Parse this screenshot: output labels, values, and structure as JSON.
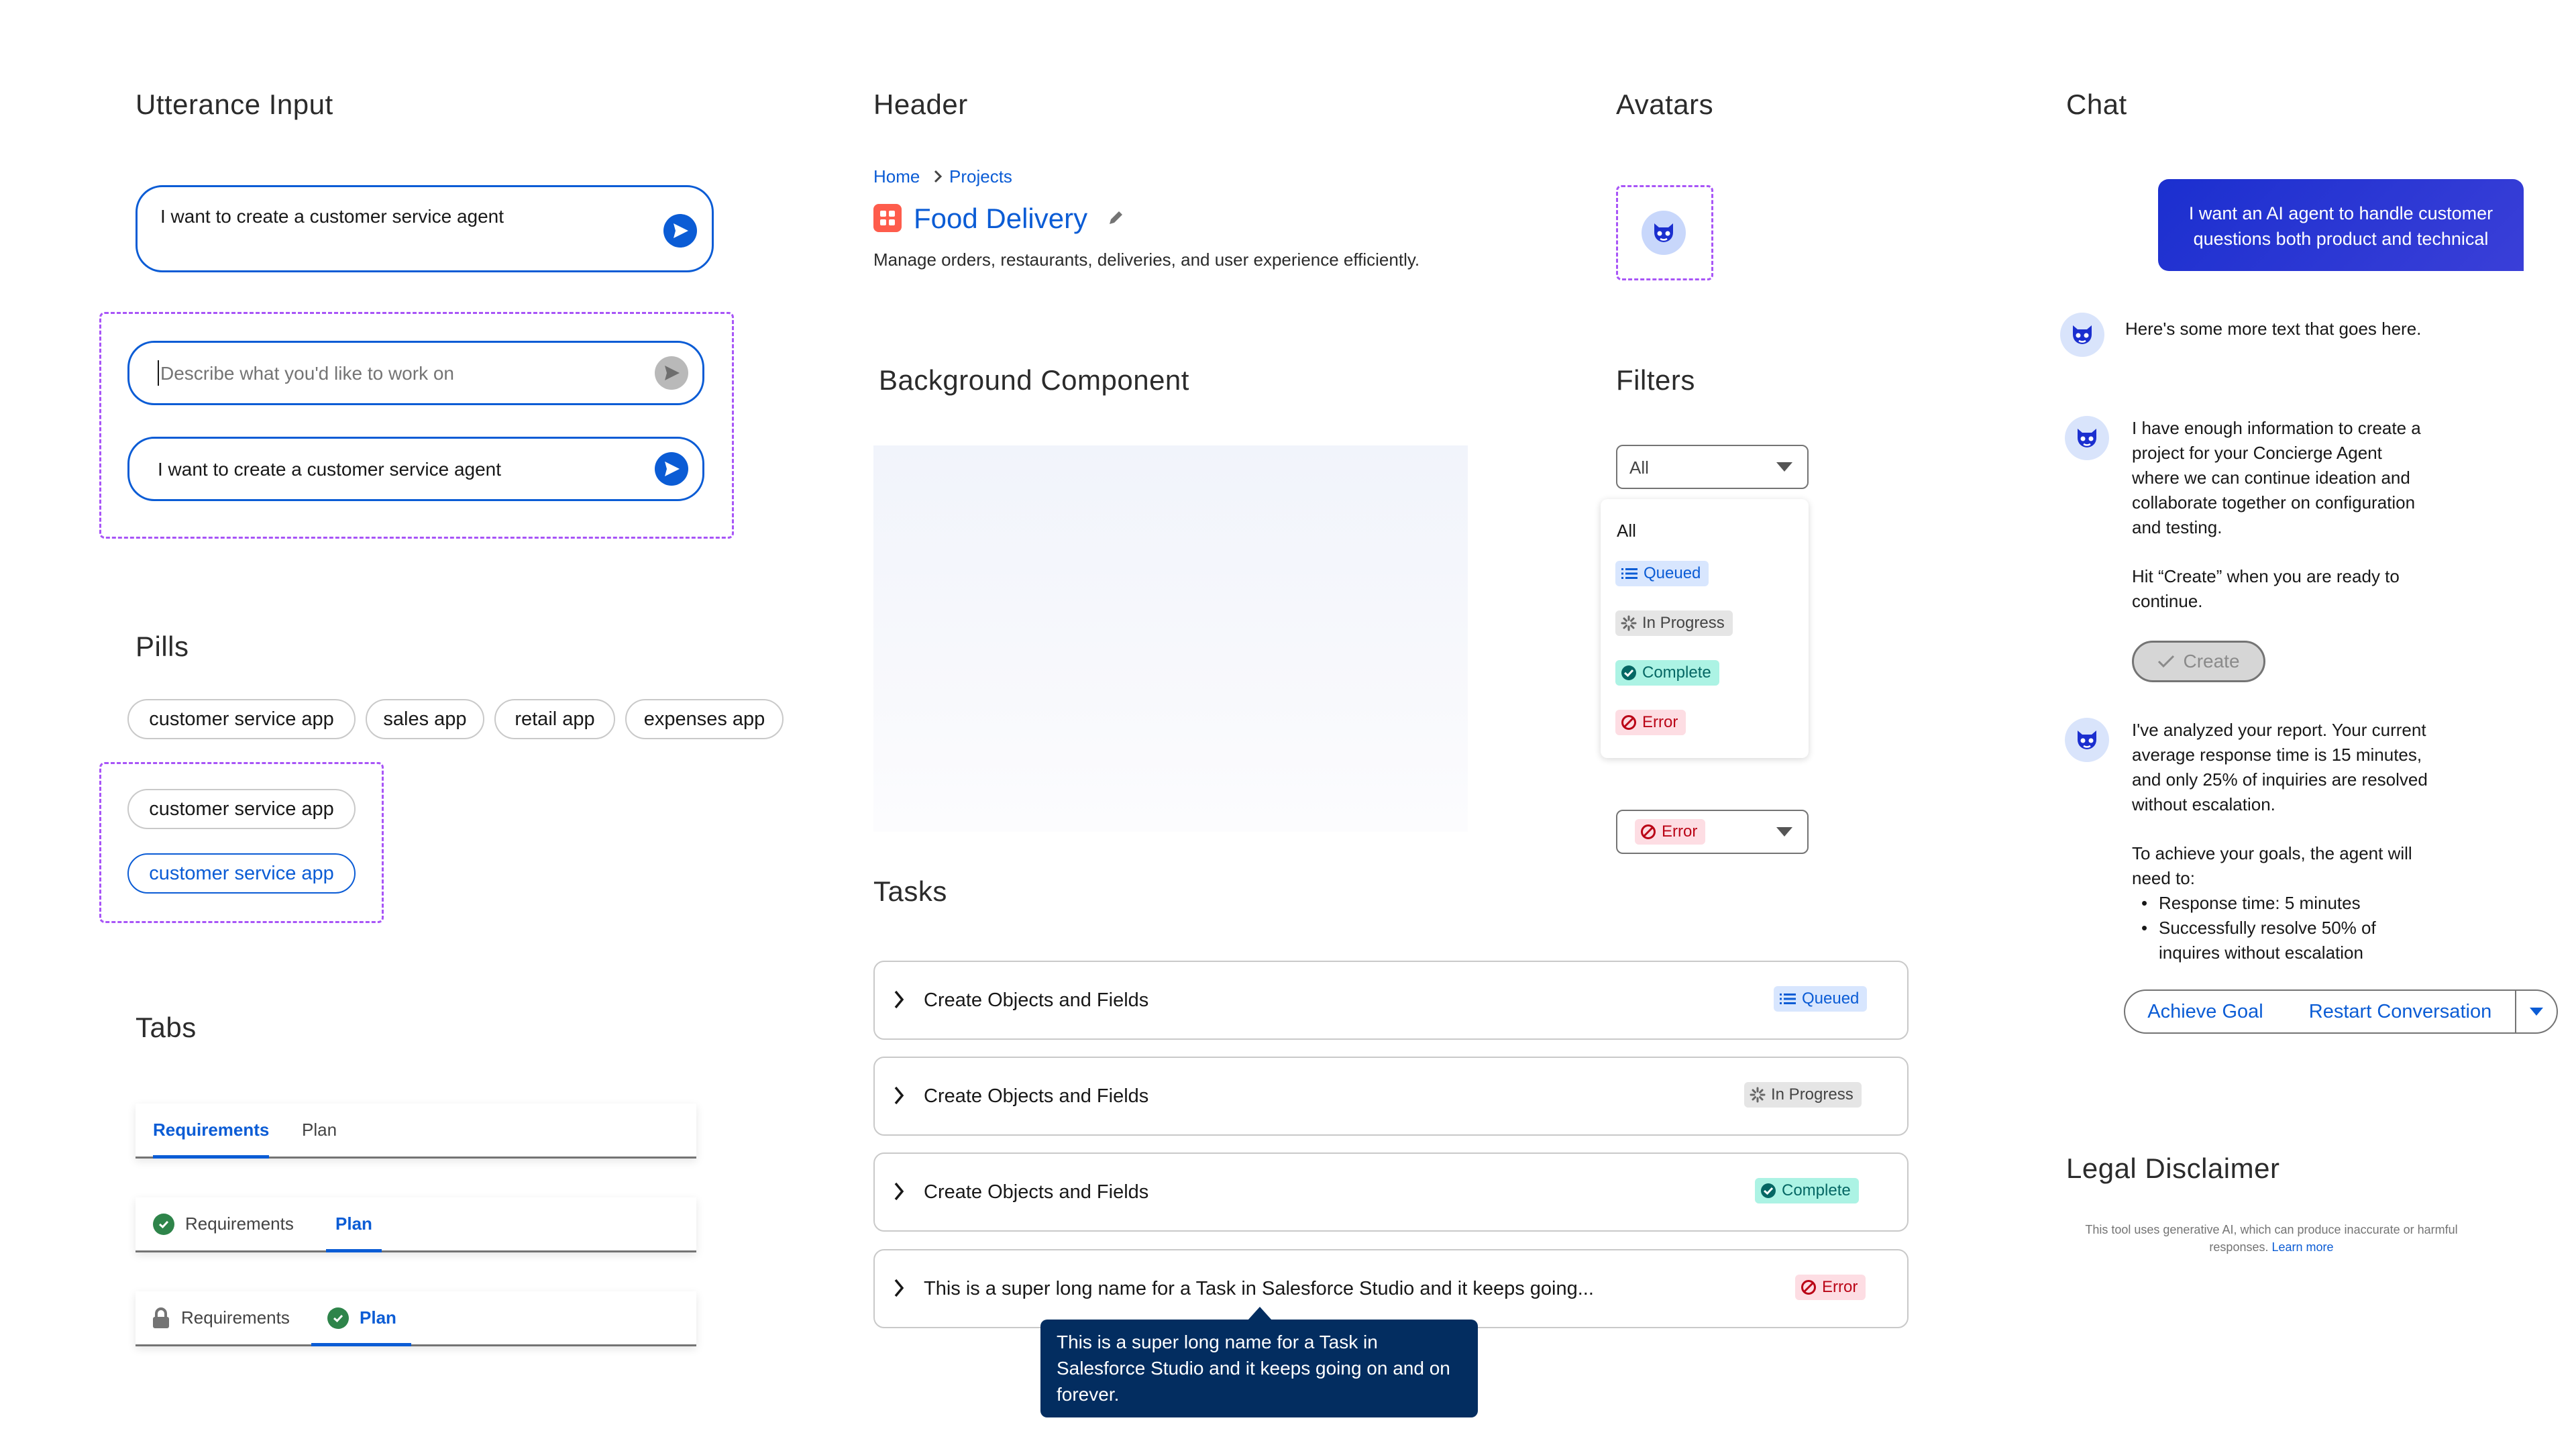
{
  "sections": {
    "utterance_input": "Utterance Input",
    "pills": "Pills",
    "tabs": "Tabs",
    "header": "Header",
    "background": "Background Component",
    "tasks": "Tasks",
    "avatars": "Avatars",
    "filters": "Filters",
    "chat": "Chat",
    "legal": "Legal Disclaimer"
  },
  "utterance": {
    "main_value": "I want to create a customer service agent",
    "placeholder": "Describe what you'd like to work on",
    "active_value": "I want to create a customer service agent"
  },
  "pills": {
    "row": [
      "customer service app",
      "sales app",
      "retail app",
      "expenses app"
    ],
    "default_label": "customer service app",
    "selected_label": "customer service app"
  },
  "tabs": {
    "row1": {
      "requirements": "Requirements",
      "plan": "Plan"
    },
    "row2": {
      "requirements": "Requirements",
      "plan": "Plan"
    },
    "row3": {
      "requirements": "Requirements",
      "plan": "Plan"
    }
  },
  "header": {
    "breadcrumb": [
      "Home",
      "Projects"
    ],
    "title": "Food Delivery",
    "description": "Manage orders, restaurants, deliveries, and user experience efficiently."
  },
  "status": {
    "queued": "Queued",
    "in_progress": "In Progress",
    "complete": "Complete",
    "error": "Error"
  },
  "tasks": [
    {
      "name": "Create Objects and Fields",
      "status": "Queued"
    },
    {
      "name": "Create Objects and Fields",
      "status": "In Progress"
    },
    {
      "name": "Create Objects and Fields",
      "status": "Complete"
    },
    {
      "name": "This is a super long name for a Task in Salesforce Studio and it keeps going...",
      "status": "Error"
    }
  ],
  "tooltip": "This is a super long name for a Task in Salesforce Studio and it keeps going on and on forever.",
  "filters": {
    "select_value": "All",
    "options": [
      "All",
      "Queued",
      "In Progress",
      "Complete",
      "Error"
    ],
    "second_select_value": "Error"
  },
  "chat": {
    "user_message": "I want an AI agent to handle customer questions both product and technical",
    "msg1": "Here's some more text that goes here.",
    "msg2_lines": [
      "I have enough information to create a",
      "project for your Concierge Agent",
      "where we can continue ideation and",
      "collaborate together on configuration",
      "and testing."
    ],
    "msg2_hint_lines": [
      "Hit “Create” when you are ready to",
      "continue."
    ],
    "create_label": "Create",
    "msg3_lines": [
      "I've analyzed your report. Your current",
      "average response time is 15 minutes,",
      "and only 25% of inquiries are resolved",
      "without escalation."
    ],
    "msg3_goal_lines": [
      "To achieve your goals, the agent will",
      "need to:"
    ],
    "msg3_bullets": [
      [
        "Response time: 5 minutes"
      ],
      [
        "Successfully resolve 50% of",
        "inquires without escalation"
      ]
    ],
    "achieve_goal": "Achieve Goal",
    "restart": "Restart Conversation"
  },
  "legal": {
    "text_line1": "This tool uses generative AI, which can produce inaccurate or harmful",
    "text_line2": "responses.",
    "link": "Learn more"
  },
  "colors": {
    "brand_blue": "#0b5cd5",
    "chat_bubble_start": "#1b2fcf",
    "chat_bubble_end": "#3a3fd8",
    "selection_dash": "#a855f7",
    "app_icon": "#fe5c4c",
    "tooltip_bg": "#032d60"
  }
}
